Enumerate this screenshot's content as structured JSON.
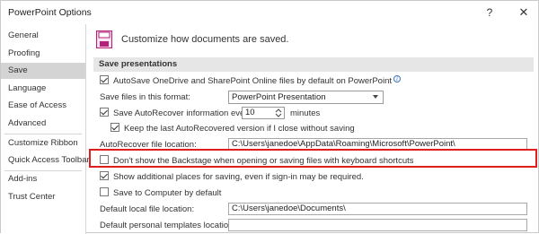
{
  "window": {
    "title": "PowerPoint Options",
    "help_glyph": "?",
    "close_glyph": "✕"
  },
  "sidebar": {
    "items": [
      {
        "label": "General"
      },
      {
        "label": "Proofing"
      },
      {
        "label": "Save",
        "selected": true
      },
      {
        "label": "Language"
      },
      {
        "label": "Ease of Access"
      },
      {
        "label": "Advanced"
      },
      {
        "label": "Customize Ribbon"
      },
      {
        "label": "Quick Access Toolbar"
      },
      {
        "label": "Add-ins"
      },
      {
        "label": "Trust Center"
      }
    ]
  },
  "main": {
    "heading": "Customize how documents are saved.",
    "section_title": "Save presentations",
    "autosave_label": "AutoSave OneDrive and SharePoint Online files by default on PowerPoint",
    "save_format_label": "Save files in this format:",
    "save_format_value": "PowerPoint Presentation",
    "autorecover_label": "Save AutoRecover information every",
    "autorecover_value": "10",
    "autorecover_unit": "minutes",
    "keep_last_label": "Keep the last AutoRecovered version if I close without saving",
    "autorecover_location_label": "AutoRecover file location:",
    "autorecover_location_value": "C:\\Users\\janedoe\\AppData\\Roaming\\Microsoft\\PowerPoint\\",
    "backstage_label": "Don't show the Backstage when opening or saving files with keyboard shortcuts",
    "additional_places_label": "Show additional places for saving, even if sign-in may be required.",
    "save_to_computer_label": "Save to Computer by default",
    "default_local_label": "Default local file location:",
    "default_local_value": "C:\\Users\\janedoe\\Documents\\",
    "default_templates_label": "Default personal templates location:",
    "default_templates_value": ""
  },
  "colors": {
    "highlight": "#e01e1e",
    "accent": "#b4227a",
    "selected_nav": "#d4d4d4"
  }
}
